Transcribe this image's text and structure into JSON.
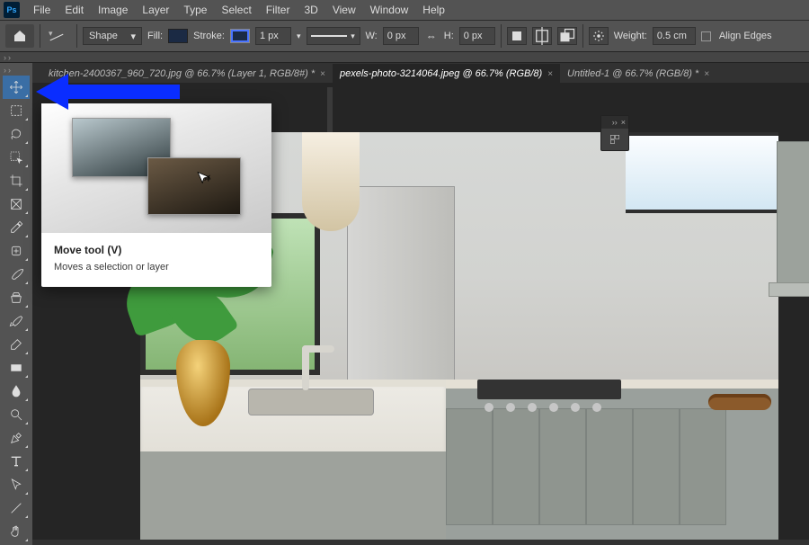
{
  "menubar": {
    "logo": "Ps",
    "items": [
      "File",
      "Edit",
      "Image",
      "Layer",
      "Type",
      "Select",
      "Filter",
      "3D",
      "View",
      "Window",
      "Help"
    ]
  },
  "optionsbar": {
    "shape_mode": "Shape",
    "fill_label": "Fill:",
    "stroke_label": "Stroke:",
    "stroke_width": "1 px",
    "w_label": "W:",
    "w_value": "0 px",
    "h_label": "H:",
    "h_value": "0 px",
    "weight_label": "Weight:",
    "weight_value": "0.5 cm",
    "align_edges_label": "Align Edges",
    "fill_color": "#1b2a44",
    "stroke_color": "#1b2a44"
  },
  "tabs": [
    {
      "label": "kitchen-2400367_960_720.jpg @ 66.7% (Layer 1, RGB/8#) *",
      "active": false,
      "modified": true
    },
    {
      "label": "pexels-photo-3214064.jpeg @ 66.7% (RGB/8)",
      "active": true,
      "modified": true
    },
    {
      "label": "Untitled-1 @ 66.7% (RGB/8) *",
      "active": false,
      "modified": true
    }
  ],
  "tools": [
    {
      "name": "move-tool",
      "active": true
    },
    {
      "name": "marquee-tool"
    },
    {
      "name": "lasso-tool"
    },
    {
      "name": "quick-select-tool"
    },
    {
      "name": "crop-tool"
    },
    {
      "name": "frame-tool"
    },
    {
      "name": "eyedropper-tool"
    },
    {
      "name": "healing-brush-tool"
    },
    {
      "name": "brush-tool"
    },
    {
      "name": "clone-stamp-tool"
    },
    {
      "name": "history-brush-tool"
    },
    {
      "name": "eraser-tool"
    },
    {
      "name": "gradient-tool"
    },
    {
      "name": "blur-tool"
    },
    {
      "name": "dodge-tool"
    },
    {
      "name": "pen-tool"
    },
    {
      "name": "type-tool"
    },
    {
      "name": "path-select-tool"
    },
    {
      "name": "line-tool"
    },
    {
      "name": "hand-tool"
    }
  ],
  "tooltip": {
    "title": "Move tool (V)",
    "desc": "Moves a selection or layer"
  },
  "floating_panel": {
    "collapse_glyph": "››",
    "close_glyph": "×"
  }
}
